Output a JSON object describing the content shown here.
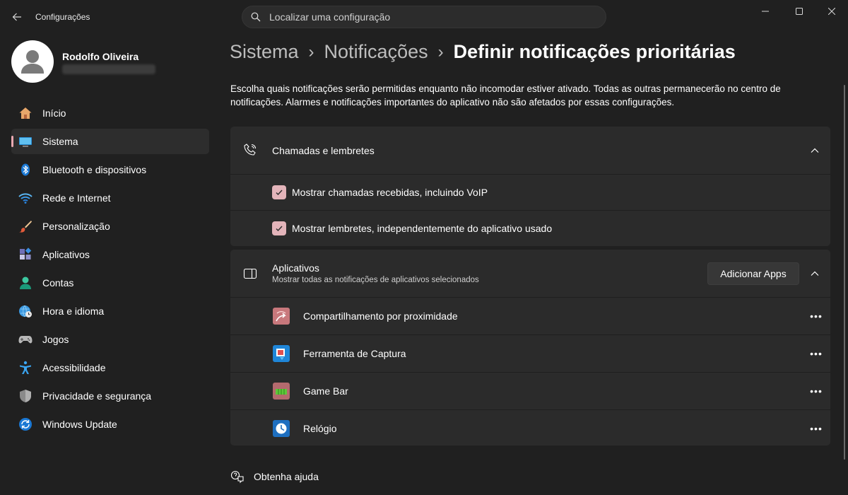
{
  "window": {
    "app_title": "Configurações",
    "search_placeholder": "Localizar uma configuração"
  },
  "profile": {
    "name": "Rodolfo Oliveira"
  },
  "sidebar": {
    "items": [
      {
        "label": "Início",
        "icon": "home-icon"
      },
      {
        "label": "Sistema",
        "icon": "system-icon",
        "active": true
      },
      {
        "label": "Bluetooth e dispositivos",
        "icon": "bluetooth-icon"
      },
      {
        "label": "Rede e Internet",
        "icon": "wifi-icon"
      },
      {
        "label": "Personalização",
        "icon": "brush-icon"
      },
      {
        "label": "Aplicativos",
        "icon": "apps-icon"
      },
      {
        "label": "Contas",
        "icon": "accounts-icon"
      },
      {
        "label": "Hora e idioma",
        "icon": "time-language-icon"
      },
      {
        "label": "Jogos",
        "icon": "gamepad-icon"
      },
      {
        "label": "Acessibilidade",
        "icon": "accessibility-icon"
      },
      {
        "label": "Privacidade e segurança",
        "icon": "shield-icon"
      },
      {
        "label": "Windows Update",
        "icon": "update-icon"
      }
    ]
  },
  "breadcrumb": {
    "level1": "Sistema",
    "level2": "Notificações",
    "current": "Definir notificações prioritárias"
  },
  "description": "Escolha quais notificações serão permitidas enquanto não incomodar estiver ativado. Todas as outras permanecerão no centro de notificações. Alarmes e notificações importantes do aplicativo não são afetados por essas configurações.",
  "calls_section": {
    "title": "Chamadas e lembretes",
    "options": [
      {
        "label": "Mostrar chamadas recebidas, incluindo VoIP",
        "checked": true
      },
      {
        "label": "Mostrar lembretes, independentemente do aplicativo usado",
        "checked": true
      }
    ]
  },
  "apps_section": {
    "title": "Aplicativos",
    "subtitle": "Mostrar todas as notificações de aplicativos selecionados",
    "add_button": "Adicionar Apps",
    "apps": [
      {
        "label": "Compartilhamento por proximidade",
        "icon": "nearby-sharing-icon"
      },
      {
        "label": "Ferramenta de Captura",
        "icon": "snipping-tool-icon"
      },
      {
        "label": "Game Bar",
        "icon": "game-bar-icon"
      },
      {
        "label": "Relógio",
        "icon": "clock-icon"
      }
    ]
  },
  "footer": {
    "help_label": "Obtenha ajuda"
  },
  "colors": {
    "background": "#202020",
    "card": "#2b2b2b",
    "accent": "#e3b4ba"
  }
}
